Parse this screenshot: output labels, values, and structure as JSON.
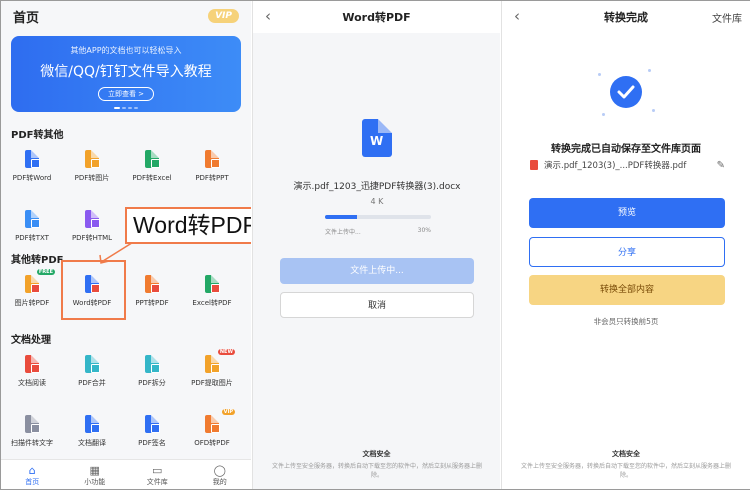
{
  "panel1": {
    "title": "首页",
    "vip": "VIP",
    "banner": {
      "subtitle": "其他APP的文档也可以轻松导入",
      "title": "微信/QQ/钉钉文件导入教程",
      "button": "立即查看 >"
    },
    "sections": [
      {
        "title": "PDF转其他",
        "rows": [
          [
            {
              "label": "PDF转Word",
              "color": "#2f6ff3",
              "mini": "#2f6ff3"
            },
            {
              "label": "PDF转图片",
              "color": "#f2a22a",
              "mini": "#f2a22a"
            },
            {
              "label": "PDF转Excel",
              "color": "#23a866",
              "mini": "#23a866"
            },
            {
              "label": "PDF转PPT",
              "color": "#f07b30",
              "mini": "#f07b30"
            }
          ],
          [
            {
              "label": "PDF转TXT",
              "color": "#3a8ef5",
              "mini": "#3a8ef5"
            },
            {
              "label": "PDF转HTML",
              "color": "#8a5af0",
              "mini": "#8a5af0"
            }
          ]
        ]
      },
      {
        "title": "其他转PDF",
        "rows": [
          [
            {
              "label": "图片转PDF",
              "color": "#f2a22a",
              "mini": "#e94c3d",
              "badge": "FREE",
              "badge_color": "#23a866"
            },
            {
              "label": "Word转PDF",
              "color": "#2f6ff3",
              "mini": "#e94c3d"
            },
            {
              "label": "PPT转PDF",
              "color": "#f07b30",
              "mini": "#e94c3d"
            },
            {
              "label": "Excel转PDF",
              "color": "#23a866",
              "mini": "#e94c3d"
            }
          ]
        ]
      },
      {
        "title": "文档处理",
        "rows": [
          [
            {
              "label": "文档阅读",
              "color": "#e94c3d",
              "mini": "#e94c3d"
            },
            {
              "label": "PDF合并",
              "color": "#34b6c8",
              "mini": "#34b6c8"
            },
            {
              "label": "PDF拆分",
              "color": "#34b6c8",
              "mini": "#34b6c8"
            },
            {
              "label": "PDF提取图片",
              "color": "#f2a22a",
              "mini": "#f2a22a",
              "badge": "NEW",
              "badge_color": "#e94c3d"
            }
          ],
          [
            {
              "label": "扫描件转文字",
              "color": "#8a8fa0",
              "mini": "#8a8fa0"
            },
            {
              "label": "文档翻译",
              "color": "#2f6ff3",
              "mini": "#2f6ff3"
            },
            {
              "label": "PDF签名",
              "color": "#2f6ff3",
              "mini": "#2f6ff3"
            },
            {
              "label": "OFD转PDF",
              "color": "#f07b30",
              "mini": "#f07b30",
              "badge": "VIP",
              "badge_color": "#f2a22a"
            }
          ]
        ]
      }
    ],
    "tabs": [
      {
        "label": "首页",
        "icon": "home-icon",
        "glyph": "⌂"
      },
      {
        "label": "小功能",
        "icon": "grid-icon",
        "glyph": "▦"
      },
      {
        "label": "文件库",
        "icon": "folder-icon",
        "glyph": "▭"
      },
      {
        "label": "我的",
        "icon": "user-icon",
        "glyph": "◯"
      }
    ],
    "callout": "Word转PDF"
  },
  "panel2": {
    "title": "Word转PDF",
    "doc_letter": "W",
    "file_name": "演示.pdf_1203_迅捷PDF转换器(3).docx",
    "file_size": "4 K",
    "progress_label": "文件上传中...",
    "progress_percent": "30%",
    "progress": 0.3,
    "upload_button": "文件上传中...",
    "cancel_button": "取消",
    "security_title": "文档安全",
    "security_text": "文件上传至安全服务器，转换后自动下载至您的软件中，然后立刻从服务器上删除。"
  },
  "panel3": {
    "title": "转换完成",
    "right_link": "文件库",
    "done_title": "转换完成已自动保存至文件库页面",
    "file_name": "演示.pdf_1203(3)_...PDF转换器.pdf",
    "preview_button": "预览",
    "share_button": "分享",
    "convert_all_button": "转换全部内容",
    "limit_note": "非会员只转换前5页",
    "security_title": "文档安全",
    "security_text": "文件上传至安全服务器，转换后自动下载至您的软件中，然后立刻从服务器上删除。"
  },
  "colors": {
    "accent": "#2f6ff3",
    "highlight": "#f07b4a",
    "gold": "#f7d583"
  }
}
